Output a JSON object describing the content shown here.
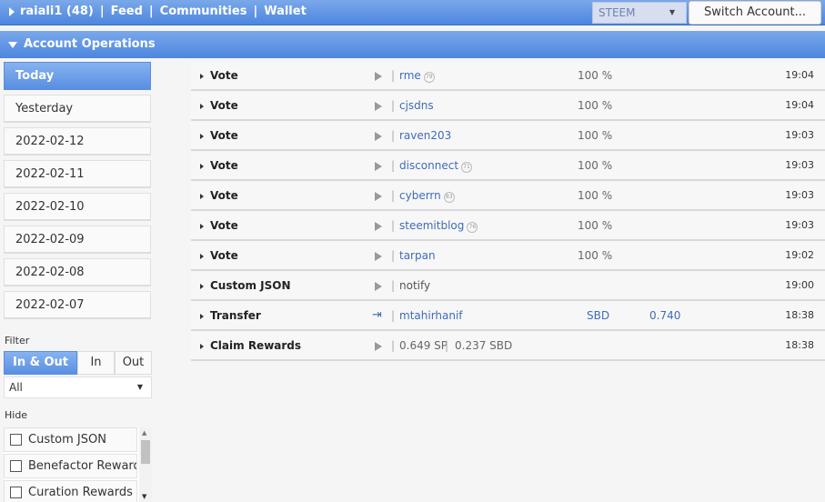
{
  "topbar": {
    "account": "raiali1 (48)",
    "links": [
      "Feed",
      "Communities",
      "Wallet"
    ],
    "separator": "|",
    "currency": "STEEM",
    "switch_label": "Switch Account..."
  },
  "section": {
    "title": "Account Operations"
  },
  "days": [
    "Today",
    "Yesterday",
    "2022-02-12",
    "2022-02-11",
    "2022-02-10",
    "2022-02-09",
    "2022-02-08",
    "2022-02-07"
  ],
  "filter": {
    "label": "Filter",
    "direction": [
      "In & Out",
      "In",
      "Out"
    ],
    "select_value": "All"
  },
  "hide": {
    "label": "Hide",
    "items": [
      "Custom JSON",
      "Benefactor Rewards",
      "Curation Rewards"
    ]
  },
  "operations": [
    {
      "type": "Vote",
      "who": "rme",
      "rep": "79",
      "pct": "100 %",
      "time": "19:04"
    },
    {
      "type": "Vote",
      "who": "cjsdns",
      "rep": "",
      "pct": "100 %",
      "time": "19:04"
    },
    {
      "type": "Vote",
      "who": "raven203",
      "rep": "",
      "pct": "100 %",
      "time": "19:03"
    },
    {
      "type": "Vote",
      "who": "disconnect",
      "rep": "71",
      "pct": "100 %",
      "time": "19:03"
    },
    {
      "type": "Vote",
      "who": "cyberrn",
      "rep": "83",
      "pct": "100 %",
      "time": "19:03"
    },
    {
      "type": "Vote",
      "who": "steemitblog",
      "rep": "76",
      "pct": "100 %",
      "time": "19:03"
    },
    {
      "type": "Vote",
      "who": "tarpan",
      "rep": "",
      "pct": "100 %",
      "time": "19:02"
    },
    {
      "type": "Custom JSON",
      "who": "notify",
      "time": "19:00"
    },
    {
      "type": "Transfer",
      "who": "mtahirhanif",
      "currency": "SBD",
      "amount": "0.740",
      "time": "18:38"
    },
    {
      "type": "Claim Rewards",
      "reward_sp": "0.649 SP",
      "reward_sbd": "0.237 SBD",
      "time": "18:38"
    }
  ],
  "icons": {
    "expand": "caret-right-icon",
    "play": "play-icon",
    "transfer_in": "sign-in-icon"
  },
  "colors": {
    "accent": "#5a90e2",
    "link": "#3f6cb8"
  }
}
